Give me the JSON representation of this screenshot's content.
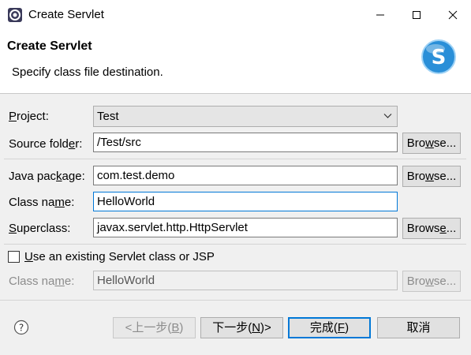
{
  "window": {
    "title": "Create Servlet",
    "icons": {
      "app": "eclipse-icon",
      "minimize": "minimize-icon",
      "maximize": "maximize-icon",
      "close": "close-icon"
    }
  },
  "banner": {
    "title": "Create Servlet",
    "description": "Specify class file destination.",
    "logo": "servlet-s-logo"
  },
  "form": {
    "project": {
      "label": "Project:",
      "mnemonic": "P",
      "rest": "roject:",
      "value": "Test"
    },
    "source_folder": {
      "label": "Source folder:",
      "pre": "Source fold",
      "mnemonic": "e",
      "rest": "r:",
      "value": "/Test/src"
    },
    "java_package": {
      "label": "Java package:",
      "pre": "Java pac",
      "mnemonic": "k",
      "rest": "age:",
      "value": "com.test.demo"
    },
    "class_name": {
      "label": "Class name:",
      "pre": "Class na",
      "mnemonic": "m",
      "rest": "e:",
      "value": "HelloWorld"
    },
    "superclass": {
      "label": "Superclass:",
      "mnemonic": "S",
      "rest": "uperclass:",
      "value": "javax.servlet.http.HttpServlet"
    },
    "use_existing": {
      "label": "Use an existing Servlet class or JSP",
      "mnemonic": "U",
      "rest": "se an existing Servlet class or JSP",
      "checked": false
    },
    "existing_class_name": {
      "label": "Class name:",
      "pre": "Class na",
      "mnemonic": "m",
      "rest": "e:",
      "value": "HelloWorld"
    },
    "browse": {
      "pre": "Bro",
      "mnemonic": "w",
      "rest": "se...",
      "label": "Browse..."
    },
    "browse_super": {
      "pre": "Brows",
      "mnemonic": "e",
      "rest": "...",
      "label": "Browse..."
    }
  },
  "buttons": {
    "back": {
      "pre": "<上一步(",
      "mnemonic": "B",
      "rest": ")",
      "label": "<上一步(B)"
    },
    "next": {
      "pre": "下一步(",
      "mnemonic": "N",
      "rest": ")>",
      "label": "下一步(N)>"
    },
    "finish": {
      "pre": "完成(",
      "mnemonic": "F",
      "rest": ")",
      "label": "完成(F)"
    },
    "cancel": {
      "label": "取消"
    }
  },
  "colors": {
    "accent": "#0078d7",
    "dialog_bg": "#f0f0f0",
    "logo_blue": "#2a8fd8"
  }
}
